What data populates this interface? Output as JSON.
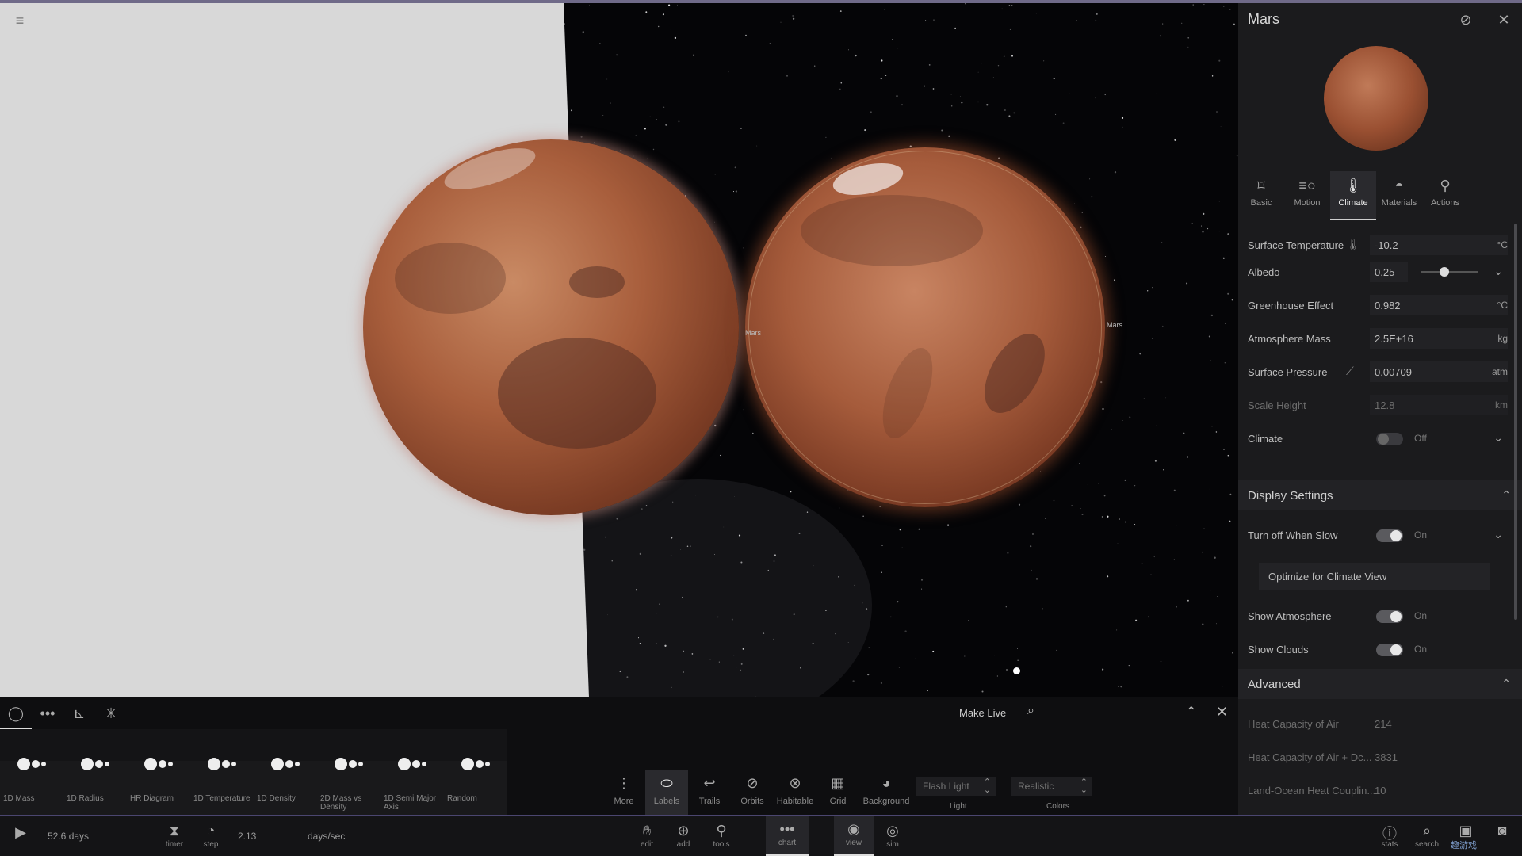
{
  "viewport": {
    "label_left": "Mars",
    "label_right": "Mars"
  },
  "panel": {
    "title": "Mars",
    "tabs": [
      {
        "label": "Basic",
        "icon": "bookmark-icon"
      },
      {
        "label": "Motion",
        "icon": "motion-icon"
      },
      {
        "label": "Climate",
        "icon": "thermometer-icon"
      },
      {
        "label": "Materials",
        "icon": "materials-icon"
      },
      {
        "label": "Actions",
        "icon": "actions-icon"
      }
    ],
    "active_tab": "Climate",
    "properties": {
      "surface_temperature": {
        "label": "Surface Temperature",
        "value": "-10.2",
        "unit": "°C"
      },
      "albedo": {
        "label": "Albedo",
        "value": "0.25",
        "slider": 0.25
      },
      "greenhouse_effect": {
        "label": "Greenhouse Effect",
        "value": "0.982",
        "unit": "°C"
      },
      "atmosphere_mass": {
        "label": "Atmosphere Mass",
        "value": "2.5E+16",
        "unit": "kg"
      },
      "surface_pressure": {
        "label": "Surface Pressure",
        "value": "0.00709",
        "unit": "atm"
      },
      "scale_height": {
        "label": "Scale Height",
        "value": "12.8",
        "unit": "km"
      },
      "climate": {
        "label": "Climate",
        "state": "Off"
      }
    },
    "display_settings": {
      "title": "Display Settings",
      "turn_off_when_slow": {
        "label": "Turn off When Slow",
        "state": "On"
      },
      "optimize_button": "Optimize for Climate View",
      "show_atmosphere": {
        "label": "Show Atmosphere",
        "state": "On"
      },
      "show_clouds": {
        "label": "Show Clouds",
        "state": "On"
      }
    },
    "advanced": {
      "title": "Advanced",
      "heat_capacity_air": {
        "label": "Heat Capacity of Air",
        "value": "214"
      },
      "heat_capacity_air_dc": {
        "label": "Heat Capacity of Air + Dc...",
        "value": "3831"
      },
      "land_ocean": {
        "label": "Land-Ocean Heat Couplin...",
        "value": "10"
      }
    }
  },
  "chart": {
    "make_live": "Make Live",
    "types": [
      {
        "label": "1D Mass"
      },
      {
        "label": "1D Radius"
      },
      {
        "label": "HR Diagram"
      },
      {
        "label": "1D Temperature"
      },
      {
        "label": "1D Density"
      },
      {
        "label": "2D Mass vs Density"
      },
      {
        "label": "1D Semi Major Axis"
      },
      {
        "label": "Random"
      }
    ]
  },
  "layers": {
    "more": "More",
    "labels": "Labels",
    "trails": "Trails",
    "orbits": "Orbits",
    "habitable": "Habitable",
    "grid": "Grid",
    "background": "Background",
    "light_value": "Flash Light",
    "light_caption": "Light",
    "colors_value": "Realistic",
    "colors_caption": "Colors"
  },
  "status": {
    "time": "52.6 days",
    "timer": "timer",
    "step": "step",
    "rate": "2.13",
    "rate_unit": "days/sec",
    "edit": "edit",
    "add": "add",
    "tools": "tools",
    "chart": "chart",
    "view": "view",
    "sim": "sim",
    "stats": "stats",
    "search": "search",
    "watermark": "趣游戏"
  }
}
